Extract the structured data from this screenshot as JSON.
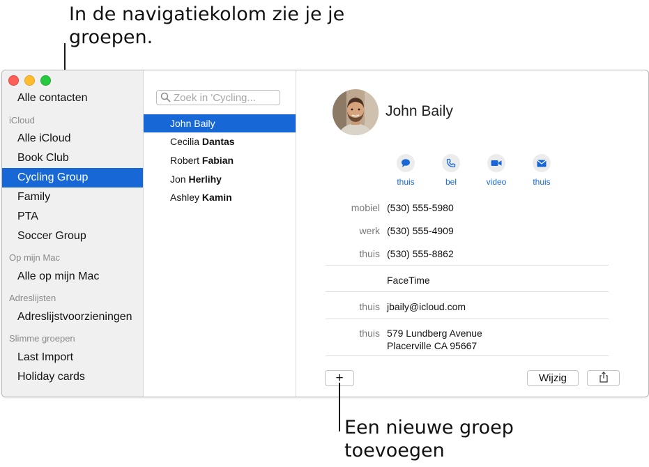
{
  "callouts": {
    "top_line1": "In de navigatiekolom zie je je",
    "top_line2": "groepen.",
    "bottom_line1": "Een nieuwe groep",
    "bottom_line2": "toevoegen"
  },
  "sidebar": {
    "top_item": "Alle contacten",
    "sections": [
      {
        "header": "iCloud",
        "items": [
          "Alle iCloud",
          "Book Club",
          "Cycling Group",
          "Family",
          "PTA",
          "Soccer Group"
        ]
      },
      {
        "header": "Op mijn Mac",
        "items": [
          "Alle op mijn Mac"
        ]
      },
      {
        "header": "Adreslijsten",
        "items": [
          "Adreslijstvoorzieningen"
        ]
      },
      {
        "header": "Slimme groepen",
        "items": [
          "Last Import",
          "Holiday cards"
        ]
      }
    ],
    "selected": "Cycling Group"
  },
  "search": {
    "placeholder": "Zoek in 'Cycling..."
  },
  "contacts": {
    "items": [
      {
        "first": "John",
        "last": "Baily"
      },
      {
        "first": "Cecilia",
        "last": "Dantas"
      },
      {
        "first": "Robert",
        "last": "Fabian"
      },
      {
        "first": "Jon",
        "last": "Herlihy"
      },
      {
        "first": "Ashley",
        "last": "Kamin"
      }
    ],
    "selected_index": 0
  },
  "card": {
    "name": "John Baily",
    "actions": [
      {
        "icon": "message-icon",
        "label": "thuis"
      },
      {
        "icon": "phone-icon",
        "label": "bel"
      },
      {
        "icon": "video-icon",
        "label": "video"
      },
      {
        "icon": "mail-icon",
        "label": "thuis"
      }
    ],
    "fields": [
      {
        "label": "mobiel",
        "value": "(530) 555-5980"
      },
      {
        "label": "werk",
        "value": "(530) 555-4909"
      },
      {
        "label": "thuis",
        "value": "(530) 555-8862"
      },
      {
        "label": "",
        "value": "FaceTime"
      },
      {
        "label": "thuis",
        "value": "jbaily@icloud.com"
      },
      {
        "label": "thuis",
        "value_lines": [
          "579 Lundberg Avenue",
          "Placerville CA 95667"
        ]
      }
    ]
  },
  "buttons": {
    "add": "+",
    "edit": "Wijzig",
    "share_icon": "share-icon"
  },
  "colors": {
    "accent": "#1768d6",
    "close": "#fe5f57",
    "minimize": "#febc2e",
    "zoom": "#28c840"
  }
}
